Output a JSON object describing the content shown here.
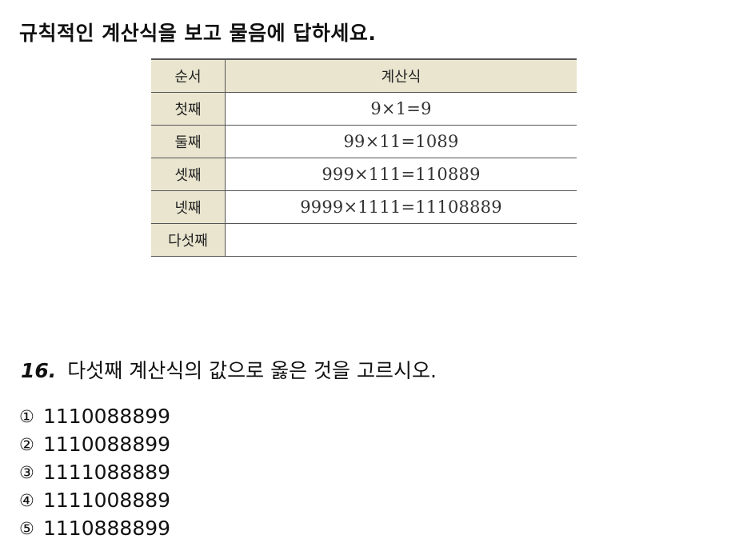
{
  "heading": "규칙적인 계산식을 보고 물음에 답하세요.",
  "table": {
    "headers": [
      "순서",
      "계산식"
    ],
    "rows": [
      {
        "order": "첫째",
        "expression": "9×1=9"
      },
      {
        "order": "둘째",
        "expression": "99×11=1089"
      },
      {
        "order": "셋째",
        "expression": "999×111=110889"
      },
      {
        "order": "넷째",
        "expression": "9999×1111=11108889"
      },
      {
        "order": "다섯째",
        "expression": ""
      }
    ]
  },
  "question": {
    "number": "16.",
    "text": "다섯째 계산식의 값으로 옳은 것을 고르시오."
  },
  "choices": [
    {
      "marker": "①",
      "value": "1110088899"
    },
    {
      "marker": "②",
      "value": "1110088899"
    },
    {
      "marker": "③",
      "value": "1111088889"
    },
    {
      "marker": "④",
      "value": "1111008889"
    },
    {
      "marker": "⑤",
      "value": "1110888899"
    }
  ],
  "colors": {
    "header_fill": "#e9e5cf",
    "rule_line": "#555555"
  }
}
